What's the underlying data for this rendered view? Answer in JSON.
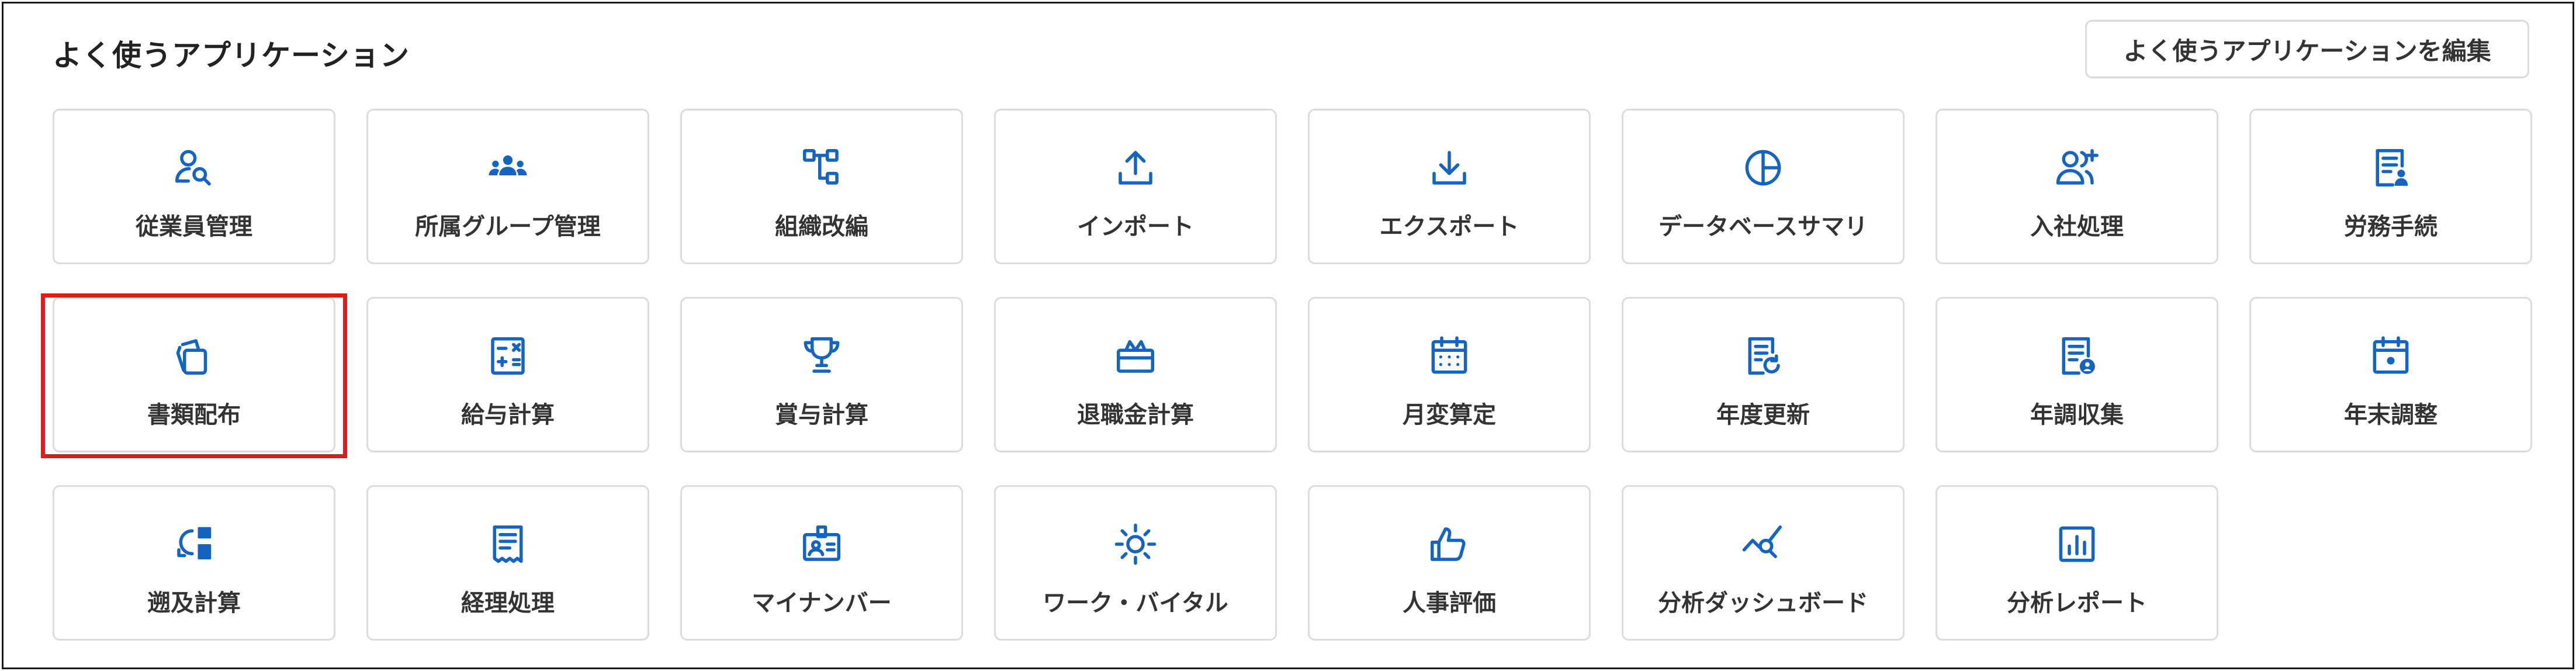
{
  "header": {
    "title": "よく使うアプリケーション",
    "edit_button_label": "よく使うアプリケーションを編集"
  },
  "colors": {
    "accent": "#1565c0",
    "highlight": "#e01b1b",
    "border": "#dcdcdc"
  },
  "apps": [
    {
      "label": "従業員管理",
      "icon": "user-search-icon"
    },
    {
      "label": "所属グループ管理",
      "icon": "group-icon"
    },
    {
      "label": "組織改編",
      "icon": "org-chart-icon"
    },
    {
      "label": "インポート",
      "icon": "upload-icon"
    },
    {
      "label": "エクスポート",
      "icon": "download-icon"
    },
    {
      "label": "データベースサマリ",
      "icon": "pie-chart-icon"
    },
    {
      "label": "入社処理",
      "icon": "user-add-icon"
    },
    {
      "label": "労務手続",
      "icon": "document-user-icon"
    },
    {
      "label": "書類配布",
      "icon": "documents-icon"
    },
    {
      "label": "給与計算",
      "icon": "calculator-icon"
    },
    {
      "label": "賞与計算",
      "icon": "trophy-icon"
    },
    {
      "label": "退職金計算",
      "icon": "gift-box-icon"
    },
    {
      "label": "月変算定",
      "icon": "calendar-icon"
    },
    {
      "label": "年度更新",
      "icon": "document-refresh-icon"
    },
    {
      "label": "年調収集",
      "icon": "document-person-icon"
    },
    {
      "label": "年末調整",
      "icon": "calendar-dot-icon"
    },
    {
      "label": "遡及計算",
      "icon": "retro-calc-icon"
    },
    {
      "label": "経理処理",
      "icon": "receipt-icon"
    },
    {
      "label": "マイナンバー",
      "icon": "id-card-icon"
    },
    {
      "label": "ワーク・バイタル",
      "icon": "sun-icon"
    },
    {
      "label": "人事評価",
      "icon": "thumbs-up-icon"
    },
    {
      "label": "分析ダッシュボード",
      "icon": "analytics-search-icon"
    },
    {
      "label": "分析レポート",
      "icon": "bar-report-icon"
    }
  ]
}
